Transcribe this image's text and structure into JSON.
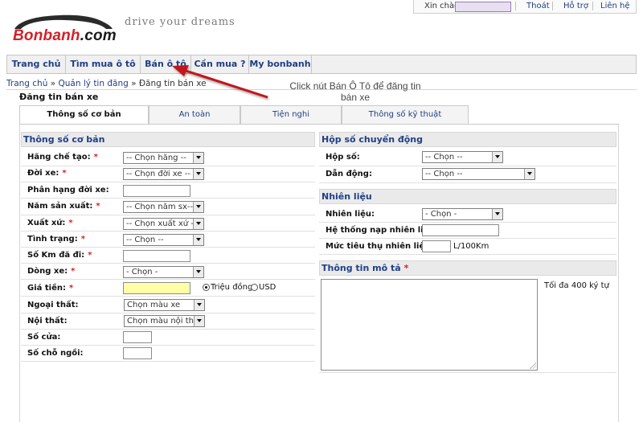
{
  "header": {
    "logo_main": "Bonbanh",
    "logo_suffix": ".com",
    "tagline": "drive your dreams",
    "greeting": "Xin chào",
    "logout": "Thoát",
    "help": "Hỗ trợ",
    "contact": "Liên hệ"
  },
  "nav": {
    "items": [
      "Trang chủ",
      "Tìm mua ô tô",
      "Bán ô tô",
      "Cần mua ?",
      "My bonbanh"
    ]
  },
  "breadcrumb": {
    "home": "Trang chủ",
    "manage": "Quản lý tin đăng",
    "current": "Đăng tin bán xe",
    "sep1": "»",
    "sep2": "»"
  },
  "page_heading": "Đăng tin bán xe",
  "annotation": "Click nút Bán Ô Tô để đăng tin bán xe",
  "tabs": [
    "Thông số cơ bản",
    "An toàn",
    "Tiện nghi",
    "Thông số kỹ thuật"
  ],
  "basic": {
    "title": "Thông số cơ bản",
    "required_mark": "*",
    "rows": {
      "maker": {
        "label": "Hãng chế tạo:",
        "value": "-- Chọn hãng --"
      },
      "model": {
        "label": "Đời xe:",
        "value": "-- Chọn đời xe --"
      },
      "variant": {
        "label": "Phân hạng đời xe:"
      },
      "year": {
        "label": "Năm sản xuất:",
        "value": "-- Chọn năm sx--"
      },
      "origin": {
        "label": "Xuất xứ:",
        "value": "-- Chọn xuất xứ --"
      },
      "condition": {
        "label": "Tình trạng:",
        "value": "-- Chọn --"
      },
      "km": {
        "label": "Số Km đã đi:"
      },
      "line": {
        "label": "Dòng xe:",
        "value": "- Chọn -"
      },
      "price": {
        "label": "Giá tiền:",
        "opt1": "Triệu đồng",
        "opt2": "USD"
      },
      "exterior": {
        "label": "Ngoại thất:",
        "value": "Chọn màu xe"
      },
      "interior": {
        "label": "Nội thất:",
        "value": "Chọn màu nội thất"
      },
      "doors": {
        "label": "Số cửa:"
      },
      "seats": {
        "label": "Số chỗ ngồi:"
      }
    }
  },
  "gearbox": {
    "title": "Hộp số chuyển động",
    "gear": {
      "label": "Hộp số:",
      "value": "-- Chọn --"
    },
    "drive": {
      "label": "Dẫn động:",
      "value": "-- Chọn --"
    }
  },
  "fuel": {
    "title": "Nhiên liệu",
    "type": {
      "label": "Nhiên liệu:",
      "value": "- Chọn -"
    },
    "system": {
      "label": "Hệ thống nạp nhiên liệu:"
    },
    "consumption": {
      "label": "Mức tiêu thụ nhiên liệu:",
      "unit": "L/100Km"
    }
  },
  "description": {
    "title": "Thông tin mô tả",
    "limit_note": "Tối đa 400 ký tự"
  }
}
